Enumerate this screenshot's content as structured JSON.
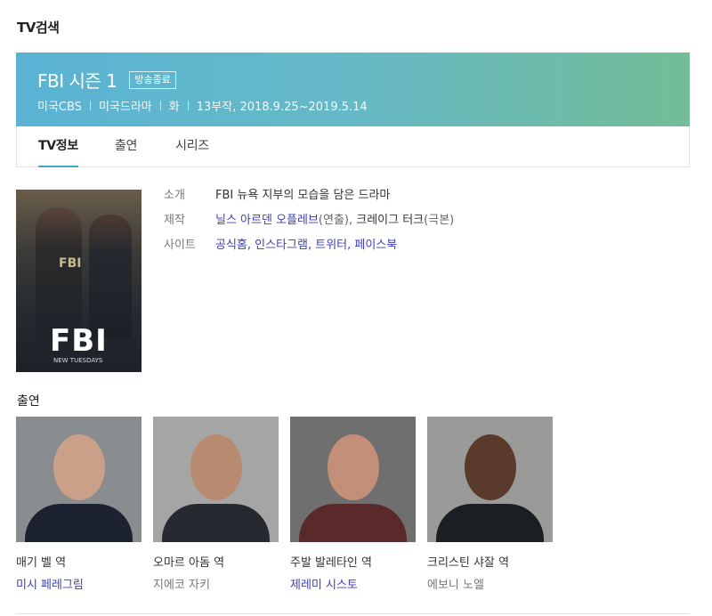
{
  "section_title": "TV검색",
  "show": {
    "title": "FBI 시즌 1",
    "badge": "방송종료",
    "meta": [
      "미국CBS",
      "미국드라마",
      "화",
      "13부작, 2018.9.25~2019.5.14"
    ]
  },
  "tabs": [
    {
      "label": "TV정보",
      "active": true
    },
    {
      "label": "출연",
      "active": false
    },
    {
      "label": "시리즈",
      "active": false
    }
  ],
  "poster": {
    "logo": "FBI",
    "small_text": "FBI",
    "tagline": "NEW TUESDAYS"
  },
  "info": {
    "intro_label": "소개",
    "intro_value": "FBI 뉴욕 지부의 모습을 담은 드라마",
    "production_label": "제작",
    "production": {
      "person1": "닐스 아르덴 오플레브",
      "role1": "(연출)",
      "comma": ", ",
      "person2": "크레이그 터크",
      "role2": "(극본)"
    },
    "site_label": "사이트",
    "sites": [
      "공식홈",
      "인스타그램",
      "트위터",
      "페이스북"
    ]
  },
  "cast_title": "출연",
  "cast": [
    {
      "role": "매기 벨 역",
      "actor": "미시 페레그림",
      "linked": true
    },
    {
      "role": "오마르 아돔 역",
      "actor": "지에코 자키",
      "linked": false
    },
    {
      "role": "주발 발레타인 역",
      "actor": "제레미 시스토",
      "linked": true
    },
    {
      "role": "크리스틴 샤잘 역",
      "actor": "에보니 노엘",
      "linked": false
    }
  ],
  "colors": {
    "link": "#3d3fb5",
    "accent": "#3ea9c4",
    "banner_start": "#5ab3d4",
    "banner_end": "#73bd97"
  }
}
